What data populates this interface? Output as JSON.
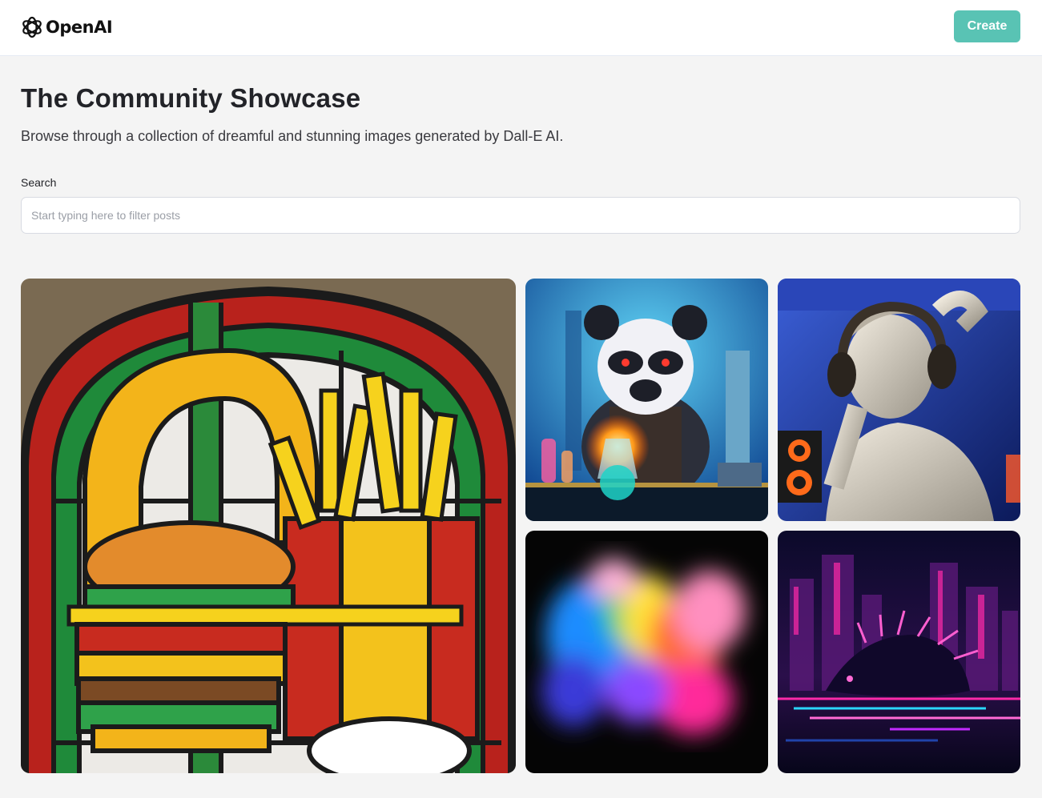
{
  "header": {
    "logo_text": "OpenAI",
    "create_label": "Create",
    "accent_color": "#59c3b4"
  },
  "main": {
    "title": "The Community Showcase",
    "subtitle": "Browse through a collection of dreamful and stunning images generated by Dall-E AI.",
    "search": {
      "label": "Search",
      "placeholder": "Start typing here to filter posts",
      "value": ""
    }
  },
  "gallery": {
    "items": [
      {
        "name": "stained-glass-burger-fries-image"
      },
      {
        "name": "panda-scientist-image"
      },
      {
        "name": "statue-headphones-image"
      },
      {
        "name": "color-powder-explosion-image"
      },
      {
        "name": "synthwave-hedgehog-image"
      }
    ]
  }
}
